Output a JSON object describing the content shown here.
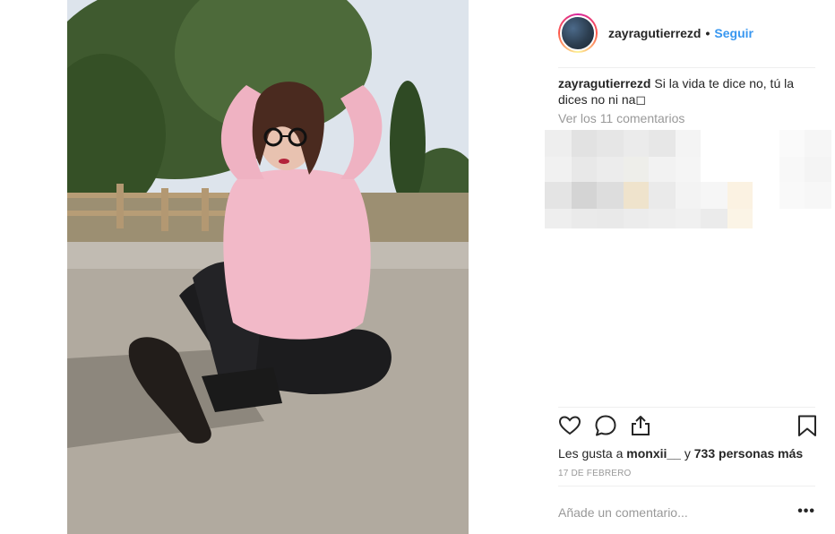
{
  "post": {
    "username": "zayragutierrezd",
    "dot": "•",
    "follow_label": "Seguir",
    "caption_user": "zayragutierrezd",
    "caption_text": " Si la vida te dice no, tú la dices no ni na◻",
    "view_comments": "Ver los 11 comentarios",
    "likes_prefix": "Les gusta a ",
    "likes_user": "monxii__",
    "likes_middle": " y ",
    "likes_count": "733 personas más",
    "date": "17 DE FEBRERO",
    "comment_placeholder": "Añade un comentario...",
    "more_label": "•••"
  },
  "icons": {
    "like": "heart-icon",
    "comment": "comment-bubble-icon",
    "share": "share-icon",
    "save": "bookmark-icon"
  },
  "colors": {
    "follow": "#3897f0",
    "muted": "#999999",
    "text": "#262626",
    "sweater": "#f2b9c8"
  }
}
